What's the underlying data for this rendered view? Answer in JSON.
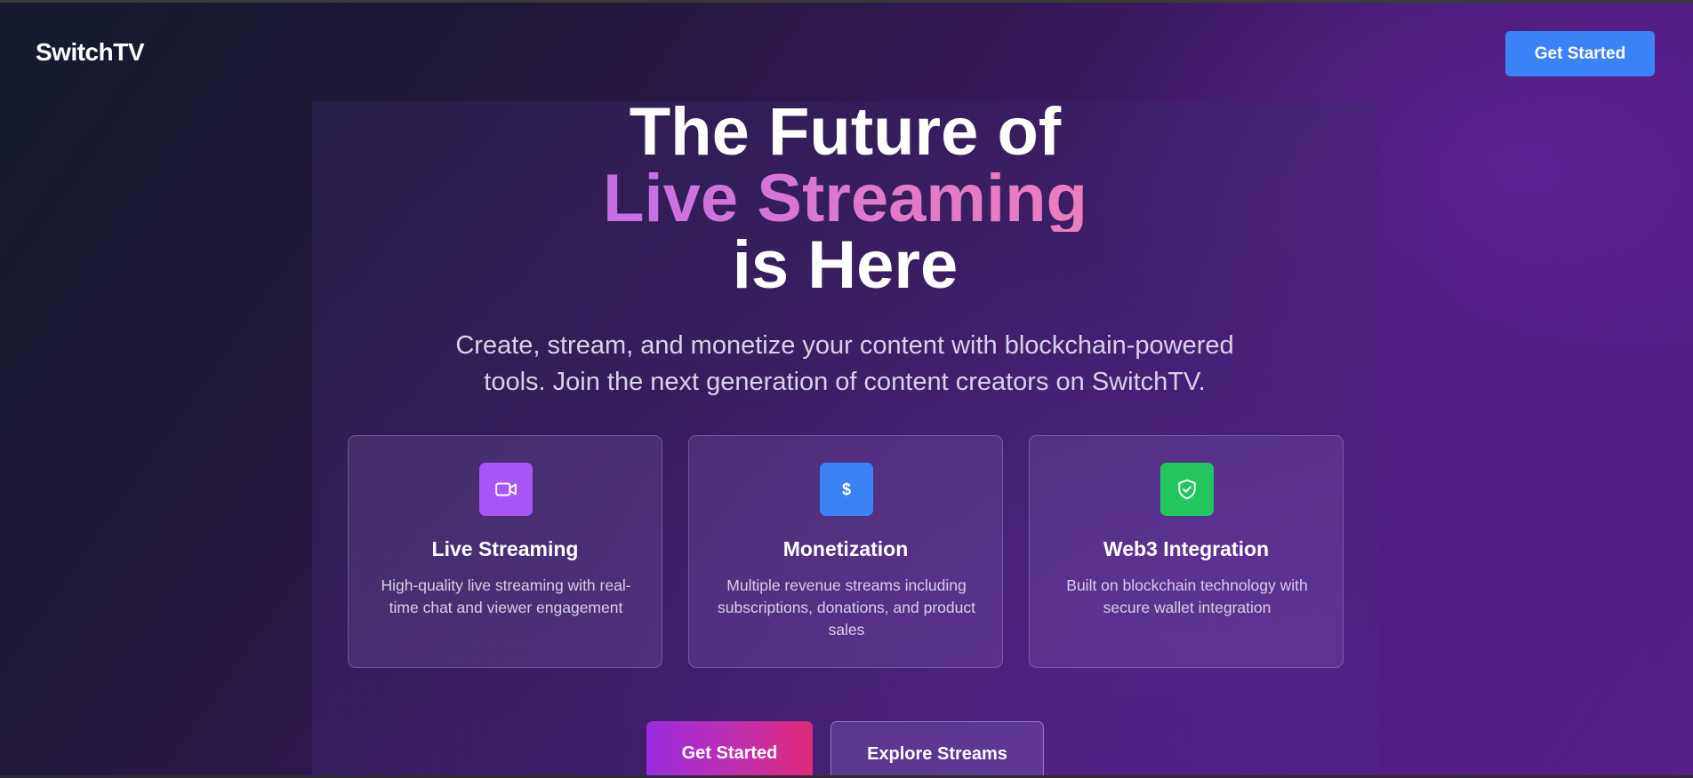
{
  "header": {
    "logo": "SwitchTV",
    "cta_label": "Get Started"
  },
  "hero": {
    "headline_line1": "The Future of",
    "headline_line2": "Live Streaming",
    "headline_line3": "is Here",
    "subtitle": "Create, stream, and monetize your content with blockchain-powered tools. Join the next generation of content creators on SwitchTV."
  },
  "features": [
    {
      "icon": "video-camera-icon",
      "icon_color": "#a855f7",
      "title": "Live Streaming",
      "description": "High-quality live streaming with real-time chat and viewer engagement"
    },
    {
      "icon": "dollar-icon",
      "icon_color": "#3b82f6",
      "title": "Monetization",
      "description": "Multiple revenue streams including subscriptions, donations, and product sales"
    },
    {
      "icon": "shield-check-icon",
      "icon_color": "#22c55e",
      "title": "Web3 Integration",
      "description": "Built on blockchain technology with secure wallet integration"
    }
  ],
  "actions": {
    "primary_label": "Get Started",
    "secondary_label": "Explore Streams"
  },
  "colors": {
    "accent_blue": "#3b82f6",
    "gradient_pink": "#ec7dc0",
    "gradient_purple": "#c66ee8"
  }
}
